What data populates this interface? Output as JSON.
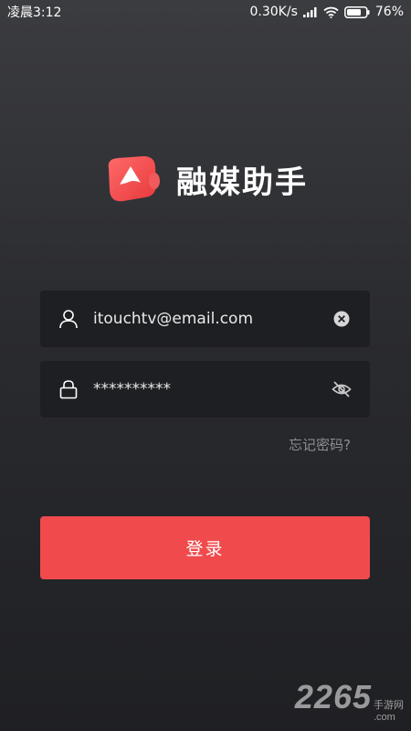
{
  "status_bar": {
    "time": "凌晨3:12",
    "network_speed": "0.30K/s",
    "battery": "76%"
  },
  "app": {
    "title": "融媒助手",
    "brand_color": "#f04a4d"
  },
  "login_form": {
    "email_value": "itouchtv@email.com",
    "password_value": "**********",
    "forgot_password_label": "忘记密码?",
    "login_label": "登录"
  },
  "icons": {
    "user": "user-icon",
    "clear": "clear-icon",
    "lock": "lock-icon",
    "hide_password": "eye-off-icon"
  },
  "watermark": {
    "number": "2265",
    "text_top": "手游网",
    "text_bottom": ".com"
  }
}
